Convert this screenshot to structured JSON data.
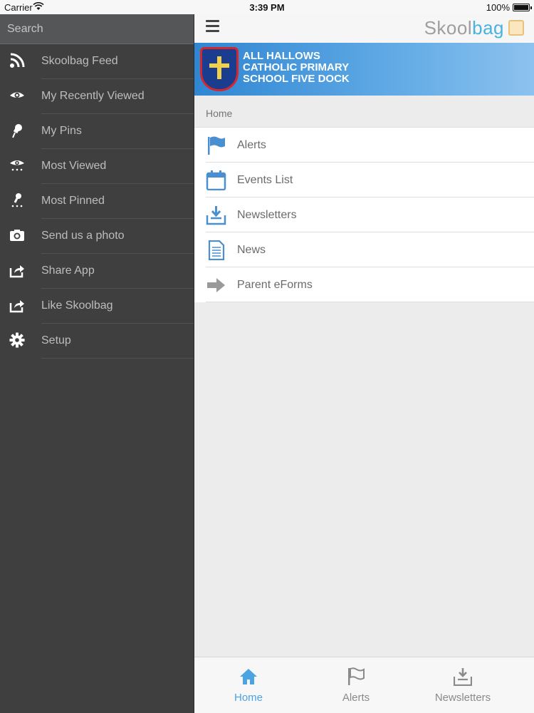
{
  "status_bar": {
    "carrier": "Carrier",
    "time": "3:39 PM",
    "battery": "100%",
    "battery_level": 1.0
  },
  "sidebar": {
    "search_placeholder": "Search",
    "items": [
      {
        "label": "Skoolbag Feed",
        "icon": "rss-icon"
      },
      {
        "label": "My Recently Viewed",
        "icon": "eye-icon"
      },
      {
        "label": "My Pins",
        "icon": "pin-icon"
      },
      {
        "label": "Most Viewed",
        "icon": "eye-dots-icon"
      },
      {
        "label": "Most Pinned",
        "icon": "pin-dots-icon"
      },
      {
        "label": "Send us a photo",
        "icon": "camera-icon"
      },
      {
        "label": "Share App",
        "icon": "share-icon"
      },
      {
        "label": "Like Skoolbag",
        "icon": "share-icon"
      },
      {
        "label": "Setup",
        "icon": "gear-icon"
      }
    ]
  },
  "header": {
    "logo_part1": "Skool",
    "logo_part2": "bag"
  },
  "banner": {
    "line1": "ALL HALLOWS",
    "line2": "CATHOLIC PRIMARY",
    "line3": "SCHOOL FIVE DOCK"
  },
  "breadcrumb": "Home",
  "list": [
    {
      "label": "Alerts",
      "icon": "flag-icon"
    },
    {
      "label": "Events List",
      "icon": "calendar-icon"
    },
    {
      "label": "Newsletters",
      "icon": "inbox-download-icon"
    },
    {
      "label": "News",
      "icon": "document-icon"
    },
    {
      "label": "Parent eForms",
      "icon": "arrow-right-icon"
    }
  ],
  "tabbar": [
    {
      "label": "Home",
      "icon": "home-icon",
      "active": true
    },
    {
      "label": "Alerts",
      "icon": "flag-icon",
      "active": false
    },
    {
      "label": "Newsletters",
      "icon": "inbox-download-icon",
      "active": false
    }
  ],
  "colors": {
    "accent": "#4aa3e2",
    "sidebar_bg": "#3f3f40",
    "banner_blue": "#2f86d2"
  }
}
